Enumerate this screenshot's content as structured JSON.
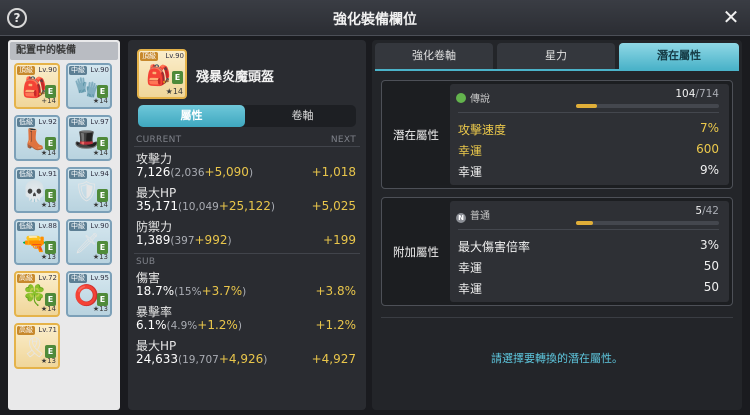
{
  "window": {
    "title": "強化裝備欄位",
    "help_icon": "?",
    "close_icon": "✕"
  },
  "equipment_panel": {
    "header": "配置中的裝備",
    "slots": [
      {
        "tier": "頂級",
        "level": "Lv.90",
        "glyph": "🎒",
        "badge": "E",
        "plus": "+14",
        "grade": "legendary"
      },
      {
        "tier": "中級",
        "level": "Lv.90",
        "glyph": "🧤",
        "badge": "E",
        "plus": "★14",
        "grade": "unique"
      },
      {
        "tier": "低級",
        "level": "Lv.92",
        "glyph": "👢",
        "badge": "E",
        "plus": "★14",
        "grade": "rare"
      },
      {
        "tier": "中級",
        "level": "Lv.97",
        "glyph": "🎩",
        "badge": "E",
        "plus": "★14",
        "grade": "unique"
      },
      {
        "tier": "低級",
        "level": "Lv.91",
        "glyph": "💀",
        "badge": "E",
        "plus": "★13",
        "grade": "rare"
      },
      {
        "tier": "中級",
        "level": "Lv.94",
        "glyph": "🛡",
        "badge": "E",
        "plus": "★14",
        "grade": "unique"
      },
      {
        "tier": "低級",
        "level": "Lv.88",
        "glyph": "🔫",
        "badge": "E",
        "plus": "★13",
        "grade": "rare"
      },
      {
        "tier": "中級",
        "level": "Lv.90",
        "glyph": "🗡",
        "badge": "E",
        "plus": "★13",
        "grade": "unique"
      },
      {
        "tier": "高級",
        "level": "Lv.72",
        "glyph": "🍀",
        "badge": "E",
        "plus": "★14",
        "grade": "epic"
      },
      {
        "tier": "中級",
        "level": "Lv.95",
        "glyph": "⭕",
        "badge": "E",
        "plus": "★13",
        "grade": "unique"
      },
      {
        "tier": "高級",
        "level": "Lv.71",
        "glyph": "🎗",
        "badge": "E",
        "plus": "★13",
        "grade": "epic"
      }
    ]
  },
  "item": {
    "tier": "頂級",
    "level": "Lv.90",
    "glyph": "🎒",
    "badge": "E",
    "plus": "★14",
    "name": "殘暴炎魔頭盔",
    "tab_attributes": "屬性",
    "tab_scroll": "卷軸",
    "col_current": "CURRENT",
    "col_next": "NEXT",
    "col_sub": "SUB",
    "main_stats": [
      {
        "label": "攻擊力",
        "value": "7,126",
        "paren_open": "(2,036",
        "bonus": "+5,090",
        "paren_close": ")",
        "next": "+1,018"
      },
      {
        "label": "最大HP",
        "value": "35,171",
        "paren_open": "(10,049",
        "bonus": "+25,122",
        "paren_close": ")",
        "next": "+5,025"
      },
      {
        "label": "防禦力",
        "value": "1,389",
        "paren_open": "(397",
        "bonus": "+992",
        "paren_close": ")",
        "next": "+199"
      }
    ],
    "sub_stats": [
      {
        "label": "傷害",
        "value": "18.7%",
        "paren_open": "(15%",
        "bonus": "+3.7%",
        "paren_close": ")",
        "next": "+3.8%"
      },
      {
        "label": "暴擊率",
        "value": "6.1%",
        "paren_open": "(4.9%",
        "bonus": "+1.2%",
        "paren_close": ")",
        "next": "+1.2%"
      },
      {
        "label": "最大HP",
        "value": "24,633",
        "paren_open": "(19,707",
        "bonus": "+4,926",
        "paren_close": ")",
        "next": "+4,927"
      }
    ]
  },
  "right_panel": {
    "tabs": [
      "強化卷軸",
      "星力",
      "潛在屬性"
    ],
    "active_tab": "潛在屬性",
    "potential": {
      "label": "潛在屬性",
      "grade_icon": "leaf-icon",
      "grade_name": "傳說",
      "progress_current": "104",
      "progress_max": "/714",
      "progress_ratio": 0.146,
      "lines": [
        {
          "name": "攻擊速度",
          "value": "7%",
          "color": "#ecc94b"
        },
        {
          "name": "幸運",
          "value": "600",
          "color": "#ecc94b"
        },
        {
          "name": "幸運",
          "value": "9%",
          "color": "#f0f0f0"
        }
      ]
    },
    "additional": {
      "label": "附加屬性",
      "grade_icon": "N",
      "grade_name": "普通",
      "progress_current": "5",
      "progress_max": "/42",
      "progress_ratio": 0.119,
      "lines": [
        {
          "name": "最大傷害倍率",
          "value": "3%"
        },
        {
          "name": "幸運",
          "value": "50"
        },
        {
          "name": "幸運",
          "value": "50"
        }
      ]
    },
    "notice": "請選擇要轉換的潛在屬性。"
  },
  "colors": {
    "accent": "#4bb3c9",
    "bonus_gold": "#e9c64b",
    "legendary_border": "#e5b34a"
  }
}
